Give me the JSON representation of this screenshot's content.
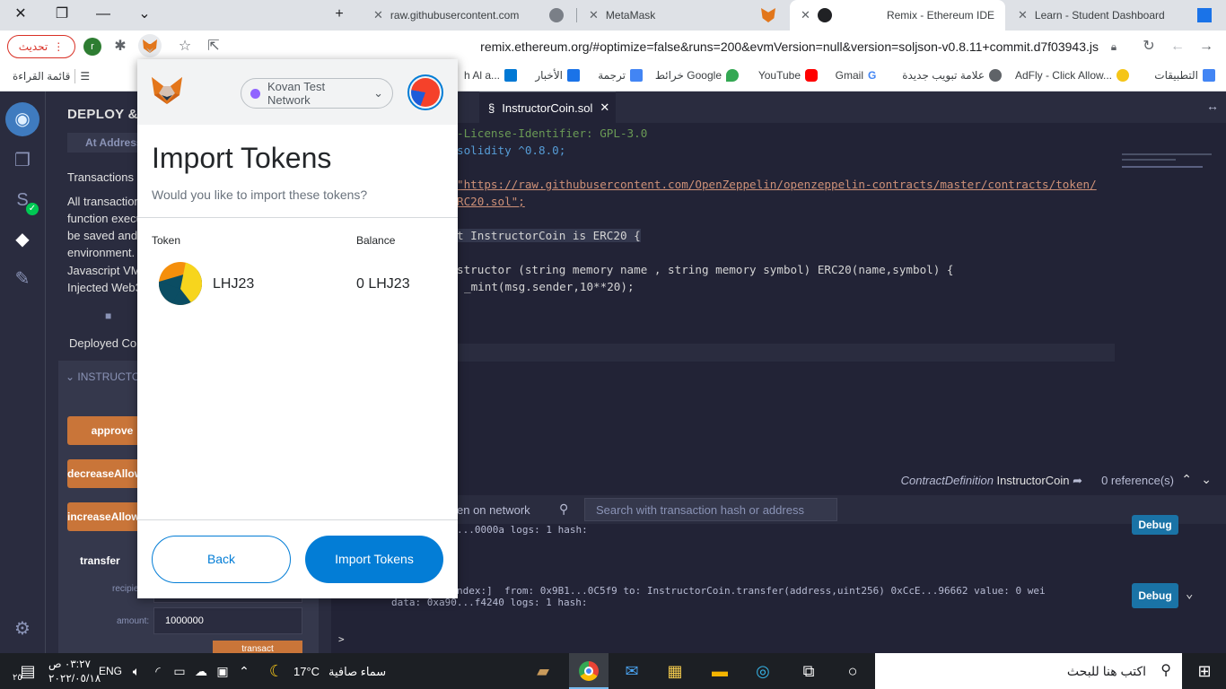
{
  "browser": {
    "tabs": [
      {
        "title": "raw.githubusercontent.com"
      },
      {
        "title": "MetaMask"
      },
      {
        "title": "Remix - Ethereum IDE"
      },
      {
        "title": "Learn - Student Dashboard"
      }
    ],
    "new_tab_symbol": "+",
    "update_label": "تحديث",
    "profile_initial": "r",
    "url": "remix.ethereum.org/#optimize=false&runs=200&evmVersion=null&version=soljson-v0.8.11+commit.d7f03943.js"
  },
  "bookmarks": {
    "items": [
      {
        "label": "التطبيقات"
      },
      {
        "label": "AdFly - Click Allow..."
      },
      {
        "label": "علامة تبويب جديدة"
      },
      {
        "label": "Gmail"
      },
      {
        "label": "YouTube"
      },
      {
        "label": "خرائط Google"
      },
      {
        "label": "ترجمة"
      },
      {
        "label": "الأخبار"
      },
      {
        "label": "h Al a..."
      }
    ],
    "reading_list": "قائمة القراءة"
  },
  "remix": {
    "panel_title": "DEPLOY &",
    "at_address": "At Address",
    "transactions_text": "Transactions r",
    "info_lines": [
      "All transaction",
      "function execu",
      "be saved and",
      "environment.",
      "Javascript VM",
      "Injected Web3"
    ],
    "deployed_contracts": "Deployed Co",
    "instance_label": "INSTRUCTOR",
    "functions": [
      "approve",
      "decreaseAllowance",
      "increaseAllowance"
    ],
    "transfer_label": "transfer",
    "params": [
      {
        "label": "recipient:",
        "value": ""
      },
      {
        "label": "amount:",
        "value": "1000000"
      }
    ],
    "transact_label": "transact",
    "file_tab": "InstructorCoin.sol",
    "code_lines": [
      "-License-Identifier: GPL-3.0",
      "solidity ^0.8.0;",
      "\"https://raw.githubusercontent.com/OpenZeppelin/openzeppelin-contracts/master/contracts/token/",
      "RC20.sol\";",
      "t InstructorCoin is ERC20 {",
      "structor (string memory name , string memory symbol) ERC20(name,symbol) {",
      "_mint(msg.sender,10**20);"
    ],
    "contract_def_prefix": "ContractDefinition",
    "contract_def_name": "InstructorCoin",
    "references": "0 reference(s)",
    "listen_text": "en on network",
    "search_placeholder": "Search with transaction hash or address",
    "term_lines": [
      "...0000a logs: 1 hash:",
      "ndex:]  from: 0x9B1...0C5f9 to: InstructorCoin.transfer(address,uint256) 0xCcE...96662 value: 0 wei",
      "data: 0xa90...f4240 logs: 1 hash:"
    ],
    "debug_label": "Debug",
    "prompt": ">"
  },
  "metamask": {
    "network": "Kovan Test Network",
    "title": "Import Tokens",
    "subtitle": "Would you like to import these tokens?",
    "col_token": "Token",
    "col_balance": "Balance",
    "token_symbol": "LHJ23",
    "token_balance": "0 LHJ23",
    "back_label": "Back",
    "import_label": "Import Tokens"
  },
  "taskbar": {
    "search_placeholder": "اكتب هنا للبحث",
    "weather_temp": "17°C",
    "weather_text": "سماء صافية",
    "language": "ENG",
    "time": "٠٣:٢٧ ص",
    "date": "٢٠٢٢/٠٥/١٨",
    "notification_count": "٢٥"
  },
  "colors": {
    "remix_bg": "#222336",
    "remix_panel": "#2a2c3f",
    "remix_button": "#c97539",
    "metamask_blue": "#037dd6",
    "network_dot": "#9064ff"
  }
}
